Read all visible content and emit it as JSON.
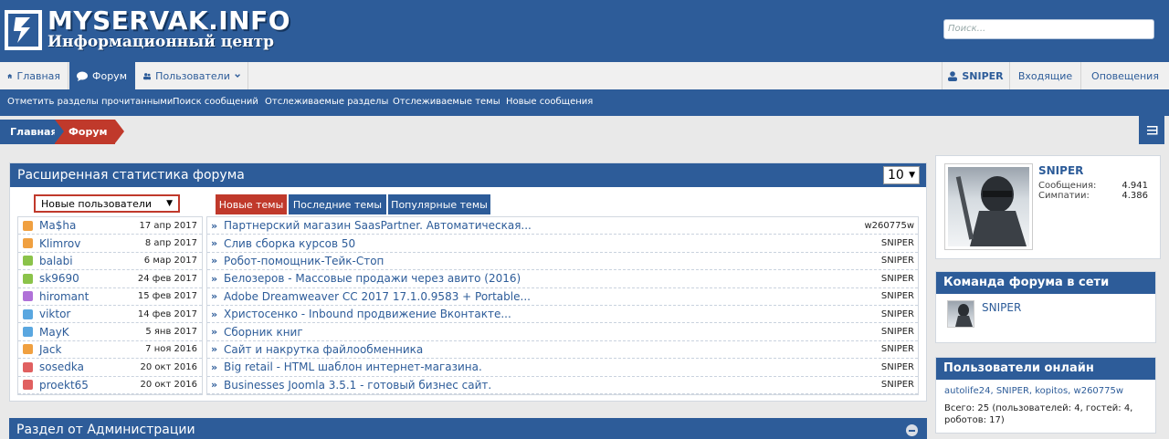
{
  "header": {
    "site_title": "MYSERVAK.INFO",
    "site_subtitle": "Информационный центр",
    "search_placeholder": "Поиск..."
  },
  "nav": {
    "home": "Главная",
    "forum": "Форум",
    "users": "Пользователи",
    "user_name": "SNIPER",
    "inbox": "Входящие",
    "alerts": "Оповещения"
  },
  "subnav": [
    "Отметить разделы прочитанными",
    "Поиск сообщений",
    "Отслеживаемые разделы",
    "Отслеживаемые темы",
    "Новые сообщения"
  ],
  "breadcrumb": {
    "home": "Главная",
    "forum": "Форум"
  },
  "stats": {
    "title": "Расширенная статистика форума",
    "count": "10",
    "user_filter": "Новые пользователи",
    "tabs": [
      "Новые темы",
      "Последние темы",
      "Популярные темы"
    ],
    "users": [
      {
        "name": "Ma$ha",
        "date": "17 апр 2017",
        "color": "#f0a040"
      },
      {
        "name": "Klimrov",
        "date": "8 апр 2017",
        "color": "#f0a040"
      },
      {
        "name": "balabi",
        "date": "6 мар 2017",
        "color": "#8bc34a"
      },
      {
        "name": "sk9690",
        "date": "24 фев 2017",
        "color": "#8bc34a"
      },
      {
        "name": "hiromant",
        "date": "15 фев 2017",
        "color": "#b071d8"
      },
      {
        "name": "viktor",
        "date": "14 фев 2017",
        "color": "#5aa7e0"
      },
      {
        "name": "MayK",
        "date": "5 янв 2017",
        "color": "#5aa7e0"
      },
      {
        "name": "Jack",
        "date": "7 ноя 2016",
        "color": "#f0a040"
      },
      {
        "name": "sosedka",
        "date": "20 окт 2016",
        "color": "#e06060"
      },
      {
        "name": "proekt65",
        "date": "20 окт 2016",
        "color": "#e06060"
      }
    ],
    "threads": [
      {
        "title": "Партнерский магазин SaasPartner. Автоматическая...",
        "author": "w260775w"
      },
      {
        "title": "Слив сборка курсов 50",
        "author": "SNIPER"
      },
      {
        "title": "Робот-помощник-Тейк-Стоп",
        "author": "SNIPER"
      },
      {
        "title": "Белозеров - Массовые продажи через авито (2016)",
        "author": "SNIPER"
      },
      {
        "title": "Adobe Dreamweaver CC 2017 17.1.0.9583 + Portable...",
        "author": "SNIPER"
      },
      {
        "title": "Христосенко - Inbound продвижение Вконтакте...",
        "author": "SNIPER"
      },
      {
        "title": "Сборник книг",
        "author": "SNIPER"
      },
      {
        "title": "Сайт и накрутка файлообменника",
        "author": "SNIPER"
      },
      {
        "title": "Big retail - HTML шаблон интернет-магазина.",
        "author": "SNIPER"
      },
      {
        "title": "Businesses Joomla 3.5.1 - готовый бизнес сайт.",
        "author": "SNIPER"
      }
    ]
  },
  "section2": {
    "title": "Раздел от Администрации"
  },
  "sidebar": {
    "profile": {
      "name": "SNIPER",
      "messages_label": "Сообщения:",
      "messages_value": "4.941",
      "likes_label": "Симпатии:",
      "likes_value": "4.386"
    },
    "staff": {
      "title": "Команда форума в сети",
      "member": "SNIPER"
    },
    "online": {
      "title": "Пользователи онлайн",
      "names": "autolife24, SNIPER, kopitos, w260775w",
      "total": "Всего: 25 (пользователей: 4, гостей: 4, роботов: 17)"
    }
  },
  "colors": {
    "primary": "#2d5c99",
    "accent": "#c0392b"
  }
}
